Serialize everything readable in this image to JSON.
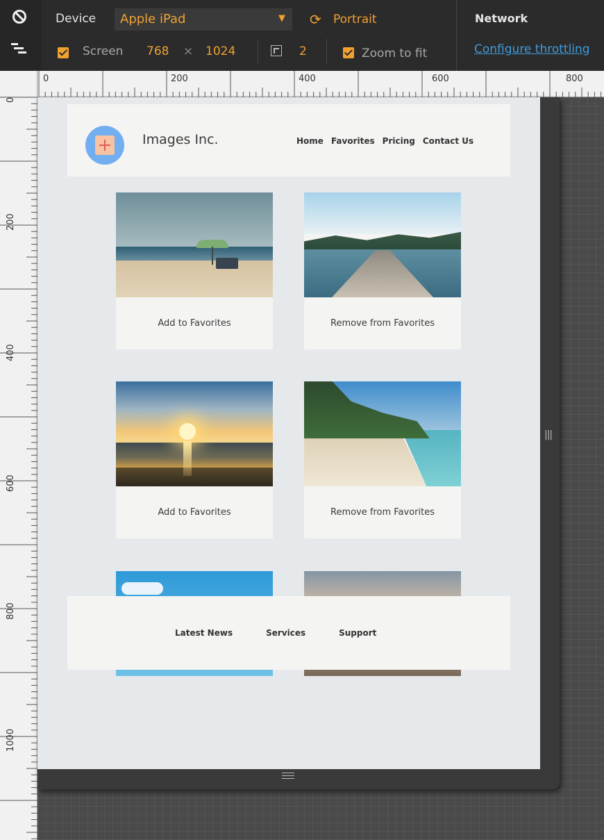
{
  "toolbar": {
    "device_label": "Device",
    "device_value": "Apple iPad",
    "orientation": "Portrait",
    "network_label": "Network",
    "network_link": "Configure throttling",
    "screen_label": "Screen",
    "screen_width": "768",
    "screen_times": "×",
    "screen_height": "1024",
    "device_pixel_ratio": "2",
    "zoom_to_fit": "Zoom to fit",
    "accent_color": "#f0a131"
  },
  "ruler": {
    "top": [
      "0",
      "200",
      "400",
      "600",
      "800"
    ],
    "left": [
      "0",
      "200",
      "400",
      "600",
      "800",
      "1000"
    ]
  },
  "site": {
    "brand": "Images Inc.",
    "nav": [
      "Home",
      "Favorites",
      "Pricing",
      "Contact Us"
    ],
    "cards": [
      {
        "button": "Add to Favorites"
      },
      {
        "button": "Remove from Favorites"
      },
      {
        "button": "Add to Favorites"
      },
      {
        "button": "Remove from Favorites"
      }
    ],
    "footer_links": [
      "Latest News",
      "Services",
      "Support"
    ]
  }
}
